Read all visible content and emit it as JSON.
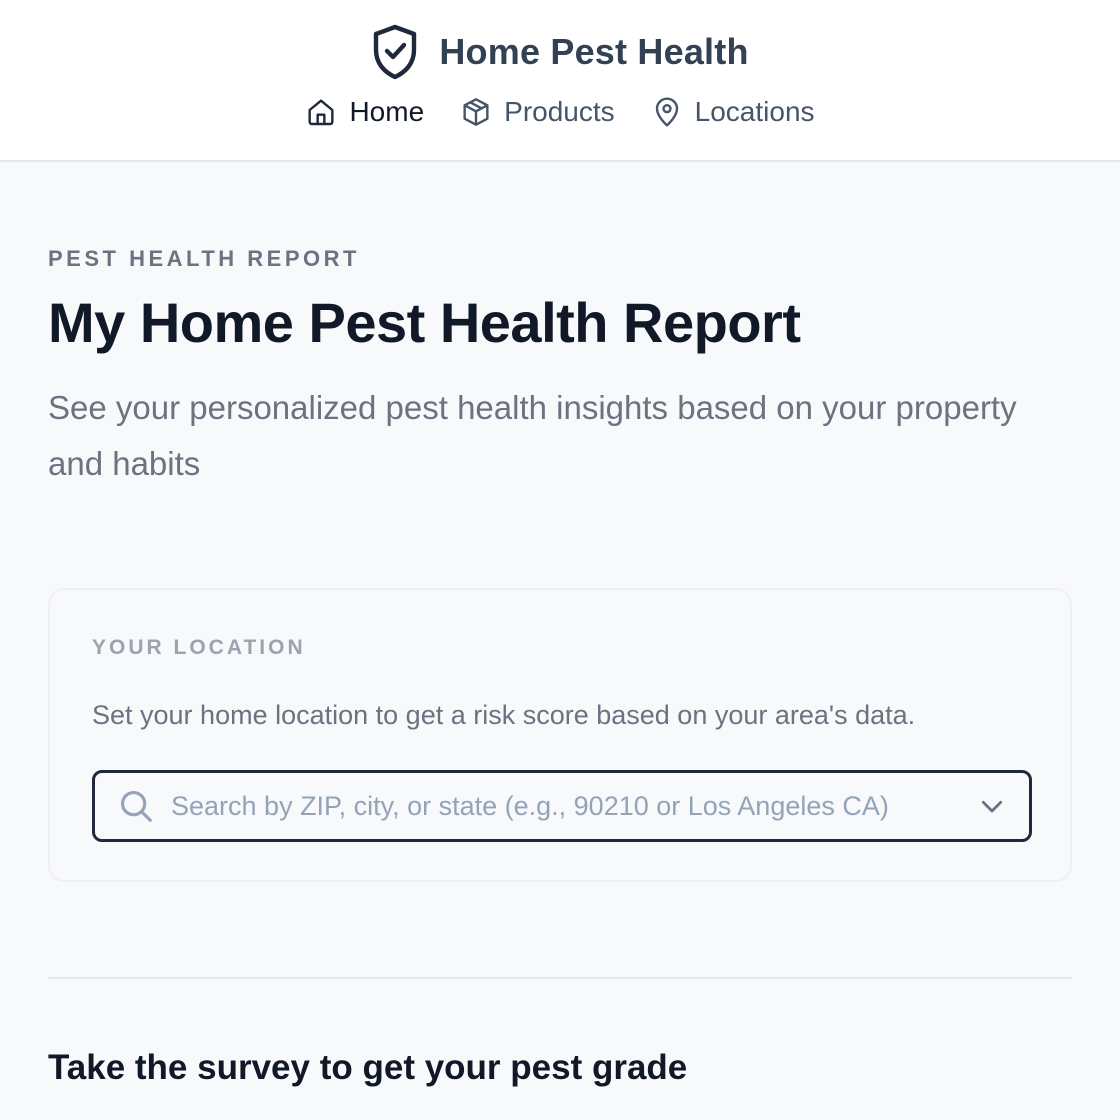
{
  "brand": {
    "name": "Home Pest Health",
    "icon": "shield-check-icon"
  },
  "nav": {
    "items": [
      {
        "label": "Home",
        "icon": "home-icon",
        "active": true
      },
      {
        "label": "Products",
        "icon": "package-icon",
        "active": false
      },
      {
        "label": "Locations",
        "icon": "map-pin-icon",
        "active": false
      }
    ]
  },
  "main": {
    "eyebrow": "PEST HEALTH REPORT",
    "title": "My Home Pest Health Report",
    "subtitle": "See your personalized pest health insights based on your property and habits"
  },
  "location_card": {
    "eyebrow": "YOUR LOCATION",
    "help_text": "Set your home location to get a risk score based on your area's data.",
    "search": {
      "value": "",
      "placeholder": "Search by ZIP, city, or state (e.g., 90210 or Los Angeles CA)"
    }
  },
  "survey": {
    "title": "Take the survey to get your pest grade",
    "subtitle": ""
  },
  "colors": {
    "brand_text": "#334155",
    "heading": "#111827",
    "muted": "#6b7280",
    "border_dark": "#1e293b",
    "page_bg": "#f8f9fb"
  }
}
